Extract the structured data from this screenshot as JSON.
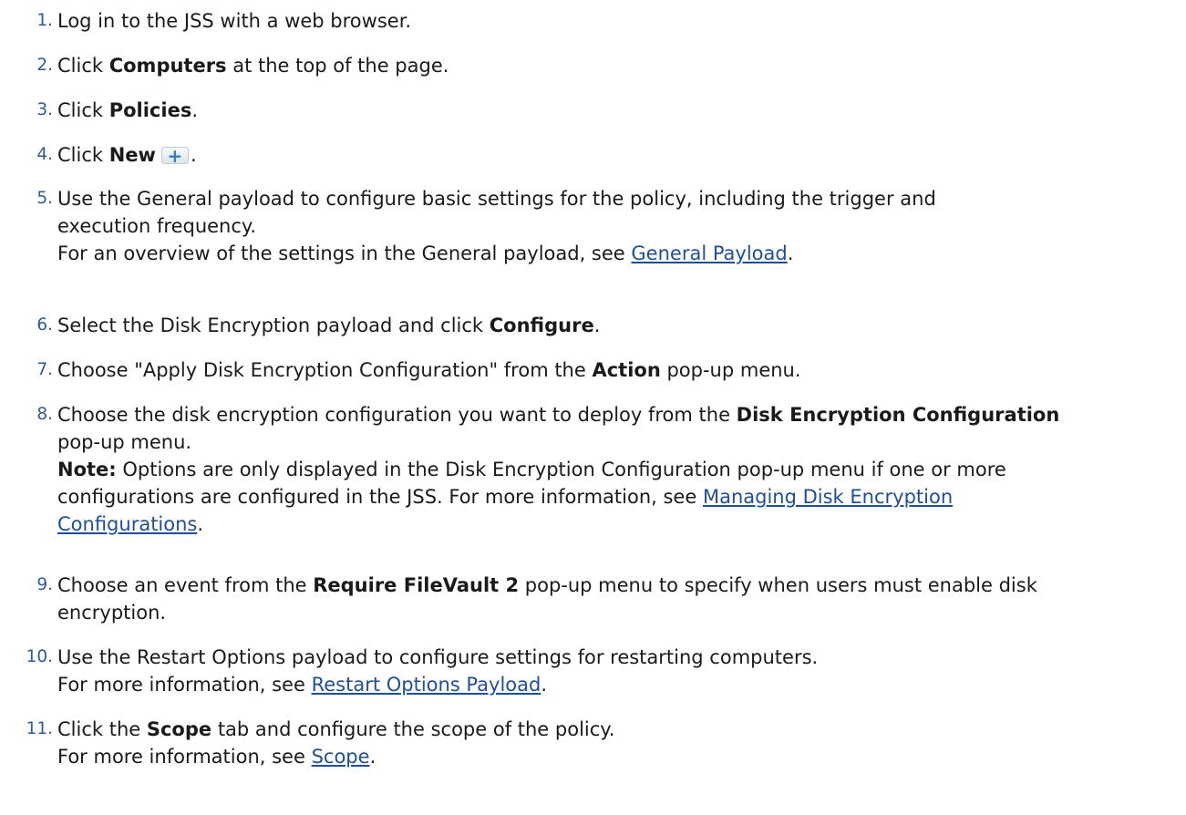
{
  "steps": [
    {
      "number": "1.",
      "text": "Log in to the JSS with a web browser."
    },
    {
      "number": "2.",
      "pre": "Click ",
      "bold": "Computers",
      "post": " at the top of the page."
    },
    {
      "number": "3.",
      "pre": "Click ",
      "bold": "Policies",
      "post": "."
    },
    {
      "number": "4.",
      "pre": "Click ",
      "bold": "New",
      "icon": "plus-icon",
      "icon_glyph": "+",
      "post": "."
    },
    {
      "number": "5.",
      "line1": "Use the General payload to configure basic settings for the policy, including the trigger and",
      "line2": "execution frequency.",
      "line3_pre": "For an overview of the settings in the General payload, see ",
      "link": "General Payload",
      "line3_post": "."
    },
    {
      "number": "6.",
      "pre": "Select the Disk Encryption payload and click ",
      "bold": "Configure",
      "post": "."
    },
    {
      "number": "7.",
      "pre": "Choose \"Apply Disk Encryption Configuration\" from the ",
      "bold": "Action",
      "post": " pop-up menu."
    },
    {
      "number": "8.",
      "line1_pre": "Choose the disk encryption configuration you want to deploy from the ",
      "line1_bold": "Disk Encryption Configuration",
      "line2": "pop-up menu.",
      "note_label": "Note:",
      "note_line1": " Options are only displayed in the Disk Encryption Configuration pop-up menu if one or more",
      "note_line2_pre": "configurations are configured in the JSS. For more information, see ",
      "link_part1": "Managing Disk Encryption",
      "link_part2": "Configurations",
      "post": "."
    },
    {
      "number": "9.",
      "line1_pre": "Choose an event from the ",
      "line1_bold": "Require FileVault 2",
      "line1_post": " pop-up menu to specify when users must enable disk",
      "line2": "encryption."
    },
    {
      "number": "10.",
      "line1": "Use the Restart Options payload to configure settings for restarting computers.",
      "line2_pre": "For more information, see ",
      "link": "Restart Options Payload",
      "line2_post": "."
    },
    {
      "number": "11.",
      "line1_pre": "Click the ",
      "line1_bold": "Scope",
      "line1_post": " tab and configure the scope of the policy.",
      "line2_pre": "For more information, see ",
      "link": "Scope",
      "line2_post": "."
    }
  ]
}
